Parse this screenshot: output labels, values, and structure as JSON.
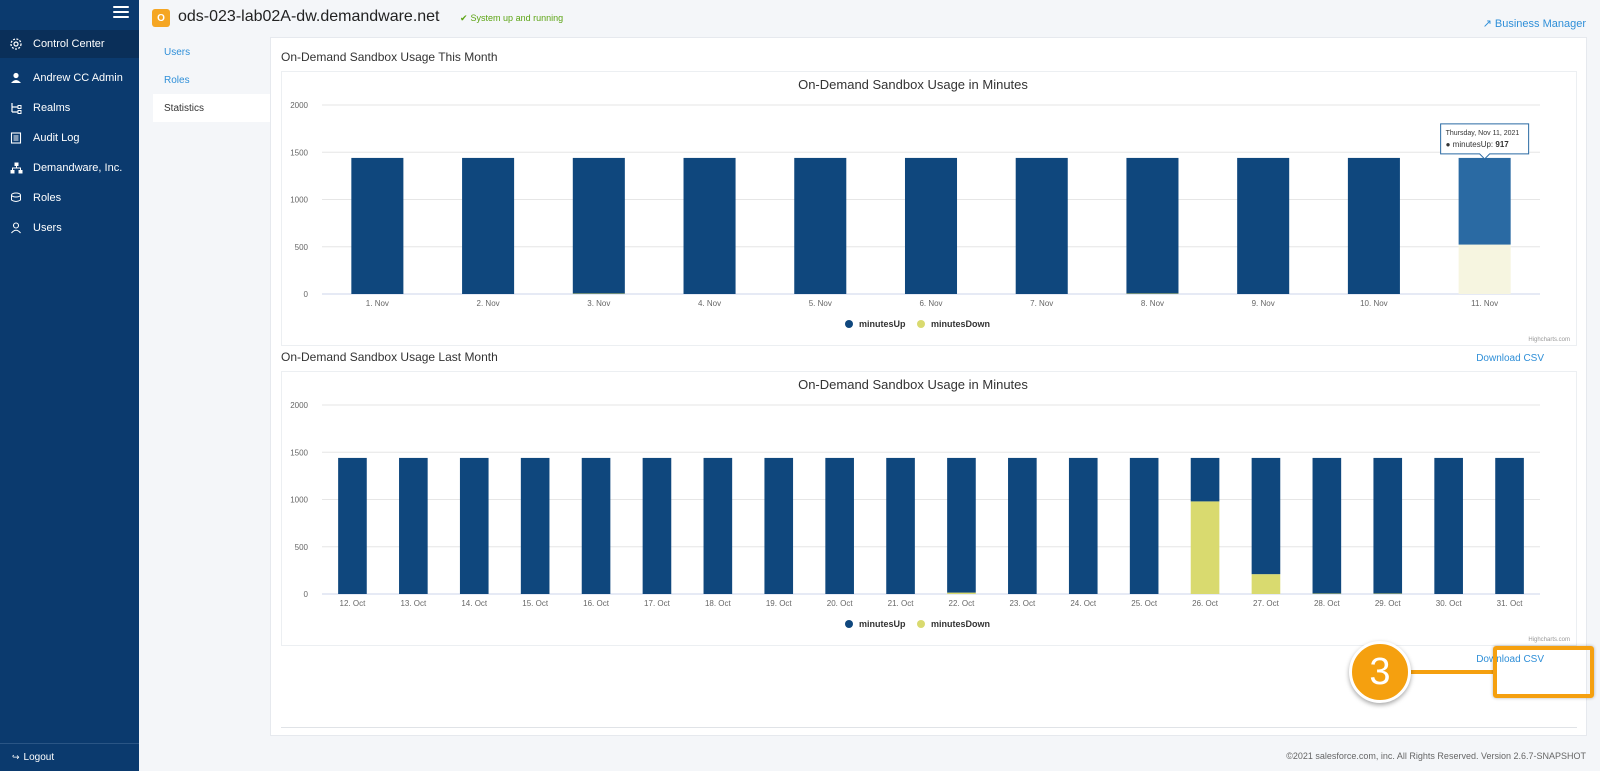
{
  "sidebar": {
    "items": [
      {
        "label": "Control Center",
        "icon": "gear-icon"
      },
      {
        "label": "Andrew CC Admin",
        "icon": "user-icon"
      },
      {
        "label": "Realms",
        "icon": "realms-icon"
      },
      {
        "label": "Audit Log",
        "icon": "log-icon"
      },
      {
        "label": "Demandware, Inc.",
        "icon": "org-icon"
      },
      {
        "label": "Roles",
        "icon": "roles-icon"
      },
      {
        "label": "Users",
        "icon": "users-icon"
      }
    ],
    "logout": "Logout"
  },
  "header": {
    "badge": "O",
    "instance": "ods-023-lab02A-dw.demandware.net",
    "status": "System up and running",
    "business_manager": "Business Manager"
  },
  "subnav": [
    "Users",
    "Roles",
    "Statistics"
  ],
  "sections": {
    "this_month": "On-Demand Sandbox Usage This Month",
    "last_month": "On-Demand Sandbox Usage Last Month",
    "download_csv": "Download CSV",
    "download_csv_2": "Download CSV"
  },
  "tooltip": {
    "date": "Thursday, Nov 11, 2021",
    "label": "minutesUp: ",
    "value": "917"
  },
  "credit": "Highcharts.com",
  "footer": "©2021 salesforce.com, inc. All Rights Reserved. Version 2.6.7-SNAPSHOT",
  "callout": "3",
  "colors": {
    "minutesUp": "#0f477d",
    "minutesUpHover": "#2a6aa3",
    "minutesDown": "#d9da6f",
    "minutesDownHover": "#f6f5e0",
    "accent": "#f5a00f",
    "link": "#2f8fd8"
  },
  "chart_data": [
    {
      "type": "bar",
      "stacked": true,
      "title": "On-Demand Sandbox Usage in Minutes",
      "ylim": [
        0,
        2000
      ],
      "yticks": [
        0,
        500,
        1000,
        1500,
        2000
      ],
      "categories": [
        "1. Nov",
        "2. Nov",
        "3. Nov",
        "4. Nov",
        "5. Nov",
        "6. Nov",
        "7. Nov",
        "8. Nov",
        "9. Nov",
        "10. Nov",
        "11. Nov"
      ],
      "series": [
        {
          "name": "minutesUp",
          "values": [
            1440,
            1440,
            1435,
            1440,
            1440,
            1440,
            1440,
            1435,
            1440,
            1440,
            917
          ]
        },
        {
          "name": "minutesDown",
          "values": [
            0,
            0,
            5,
            0,
            0,
            0,
            0,
            5,
            0,
            0,
            523
          ]
        }
      ],
      "legend": "bottom-center",
      "grid": true
    },
    {
      "type": "bar",
      "stacked": true,
      "title": "On-Demand Sandbox Usage in Minutes",
      "ylim": [
        0,
        2000
      ],
      "yticks": [
        0,
        500,
        1000,
        1500,
        2000
      ],
      "categories": [
        "12. Oct",
        "13. Oct",
        "14. Oct",
        "15. Oct",
        "16. Oct",
        "17. Oct",
        "18. Oct",
        "19. Oct",
        "20. Oct",
        "21. Oct",
        "22. Oct",
        "23. Oct",
        "24. Oct",
        "25. Oct",
        "26. Oct",
        "27. Oct",
        "28. Oct",
        "29. Oct",
        "30. Oct",
        "31. Oct"
      ],
      "series": [
        {
          "name": "minutesUp",
          "values": [
            1440,
            1440,
            1440,
            1440,
            1440,
            1440,
            1440,
            1440,
            1440,
            1440,
            1425,
            1440,
            1440,
            1440,
            460,
            1230,
            1435,
            1435,
            1440,
            1440
          ]
        },
        {
          "name": "minutesDown",
          "values": [
            0,
            0,
            0,
            0,
            0,
            0,
            0,
            0,
            0,
            0,
            15,
            0,
            0,
            0,
            980,
            210,
            5,
            5,
            0,
            0
          ]
        }
      ],
      "legend": "bottom-center",
      "grid": true
    }
  ]
}
